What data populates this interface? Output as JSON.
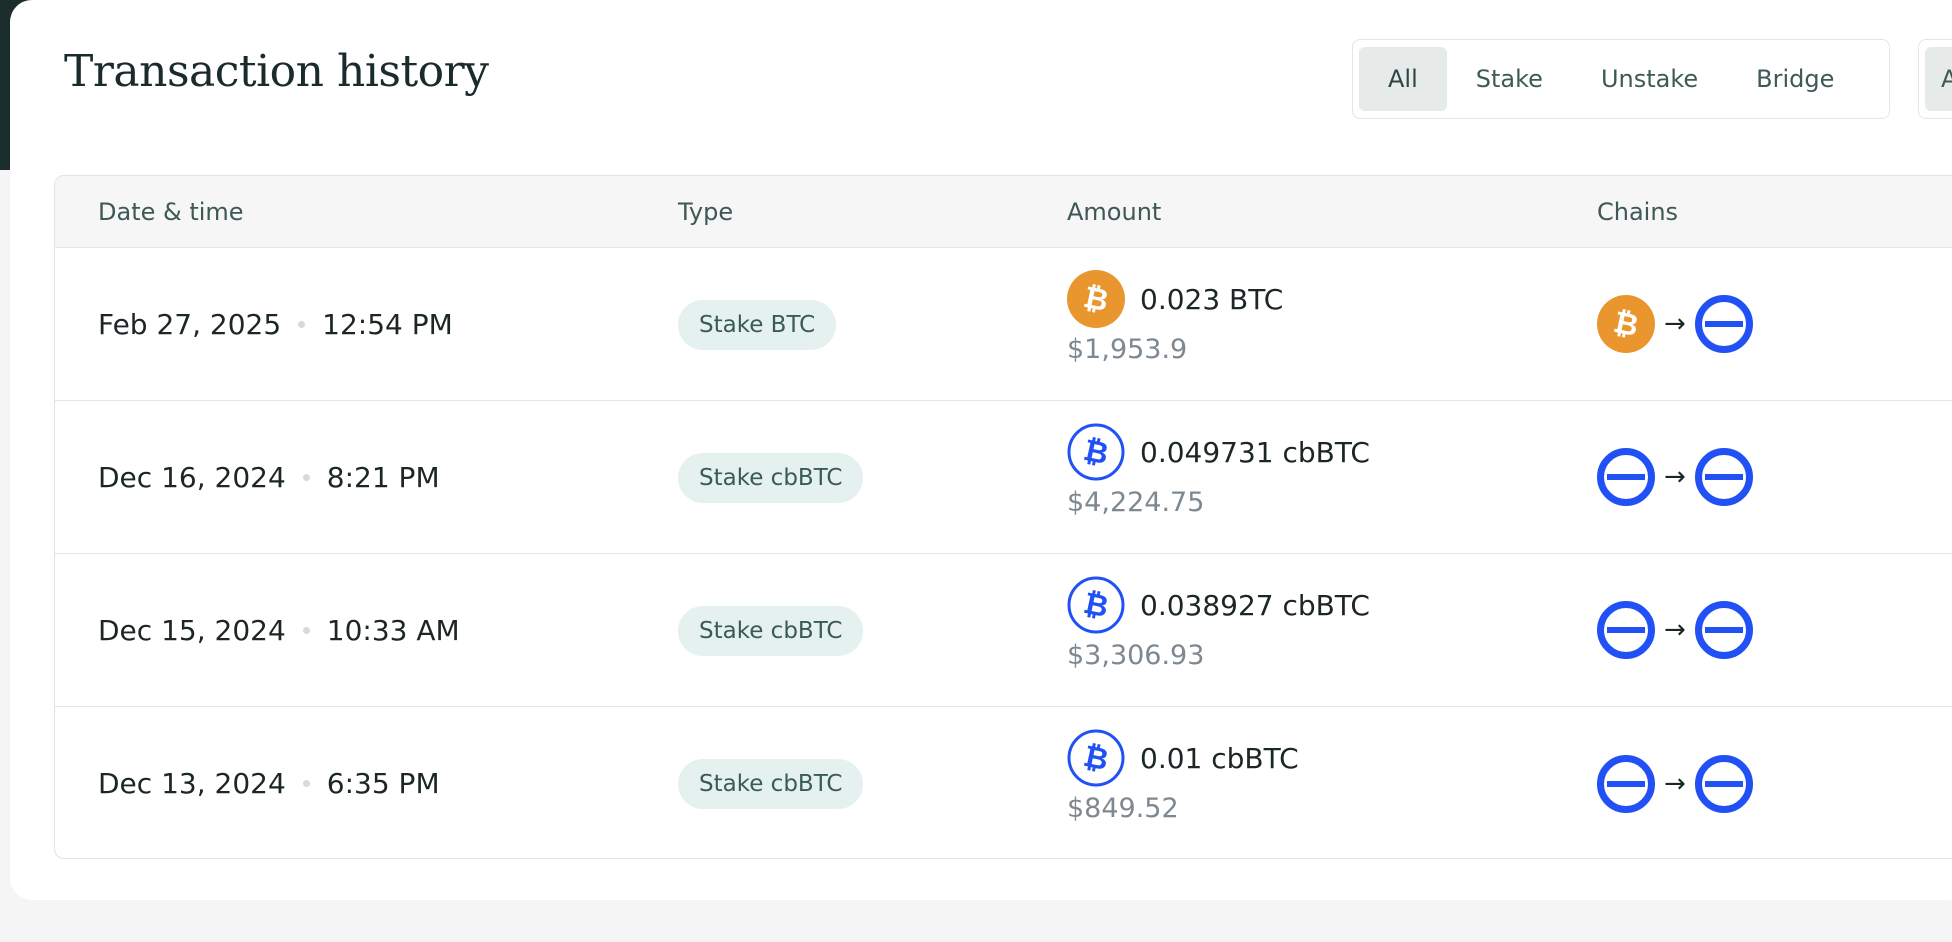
{
  "title": "Transaction history",
  "filters": [
    "All",
    "Stake",
    "Unstake",
    "Bridge"
  ],
  "filters_secondary": [
    "A"
  ],
  "columns": {
    "date": "Date & time",
    "type": "Type",
    "amount": "Amount",
    "chains": "Chains"
  },
  "rows": [
    {
      "date": "Feb 27, 2025",
      "time": "12:54 PM",
      "type": "Stake BTC",
      "amount": "0.023 BTC",
      "usd": "$1,953.9",
      "asset_icon": "bitcoin-icon",
      "from_chain_icon": "bitcoin-chain-icon",
      "to_chain_icon": "base-chain-icon"
    },
    {
      "date": "Dec 16, 2024",
      "time": "8:21 PM",
      "type": "Stake cbBTC",
      "amount": "0.049731 cbBTC",
      "usd": "$4,224.75",
      "asset_icon": "cbbtc-icon",
      "from_chain_icon": "base-chain-icon",
      "to_chain_icon": "base-chain-icon"
    },
    {
      "date": "Dec 15, 2024",
      "time": "10:33 AM",
      "type": "Stake cbBTC",
      "amount": "0.038927 cbBTC",
      "usd": "$3,306.93",
      "asset_icon": "cbbtc-icon",
      "from_chain_icon": "base-chain-icon",
      "to_chain_icon": "base-chain-icon"
    },
    {
      "date": "Dec 13, 2024",
      "time": "6:35 PM",
      "type": "Stake cbBTC",
      "amount": "0.01 cbBTC",
      "usd": "$849.52",
      "asset_icon": "cbbtc-icon",
      "from_chain_icon": "base-chain-icon",
      "to_chain_icon": "base-chain-icon"
    }
  ],
  "arrow": "→",
  "colors": {
    "bitcoin": "#E8962D",
    "base_blue": "#2151F5",
    "badge_bg": "#E4F1EE",
    "active_filter_bg": "#E6EBEA"
  }
}
